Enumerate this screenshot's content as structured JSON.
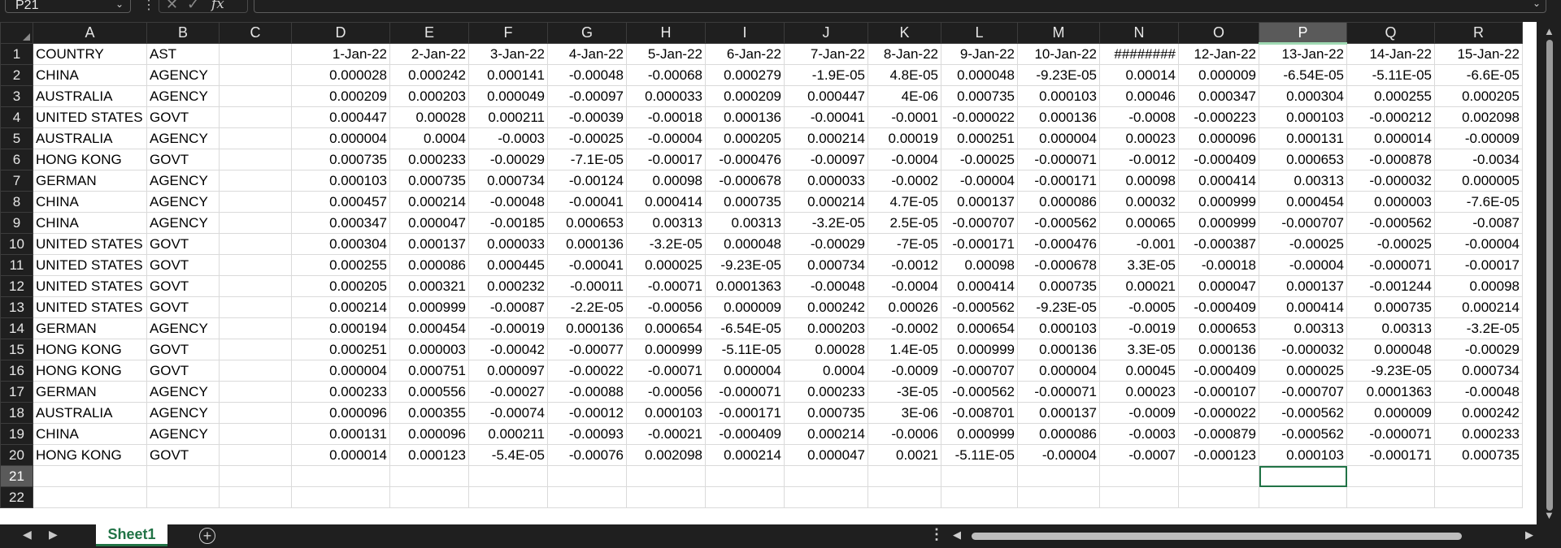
{
  "formula_bar": {
    "name_box": "P21",
    "fx": "fx",
    "formula": ""
  },
  "columns": [
    "A",
    "B",
    "C",
    "D",
    "E",
    "F",
    "G",
    "H",
    "I",
    "J",
    "K",
    "L",
    "M",
    "N",
    "O",
    "P",
    "Q",
    "R"
  ],
  "selected_column": "P",
  "selected_row": "21",
  "rows": [
    {
      "n": "1",
      "cells": [
        "COUNTRY",
        "AST",
        "",
        "1-Jan-22",
        "2-Jan-22",
        "3-Jan-22",
        "4-Jan-22",
        "5-Jan-22",
        "6-Jan-22",
        "7-Jan-22",
        "8-Jan-22",
        "9-Jan-22",
        "10-Jan-22",
        "########",
        "12-Jan-22",
        "13-Jan-22",
        "14-Jan-22",
        "15-Jan-22"
      ]
    },
    {
      "n": "2",
      "cells": [
        "CHINA",
        "AGENCY",
        "",
        "0.000028",
        "0.000242",
        "0.000141",
        "-0.00048",
        "-0.00068",
        "0.000279",
        "-1.9E-05",
        "4.8E-05",
        "0.000048",
        "-9.23E-05",
        "0.00014",
        "0.000009",
        "-6.54E-05",
        "-5.11E-05",
        "-6.6E-05"
      ]
    },
    {
      "n": "3",
      "cells": [
        "AUSTRALIA",
        "AGENCY",
        "",
        "0.000209",
        "0.000203",
        "0.000049",
        "-0.00097",
        "0.000033",
        "0.000209",
        "0.000447",
        "4E-06",
        "0.000735",
        "0.000103",
        "0.00046",
        "0.000347",
        "0.000304",
        "0.000255",
        "0.000205"
      ]
    },
    {
      "n": "4",
      "cells": [
        "UNITED STATES",
        "GOVT",
        "",
        "0.000447",
        "0.00028",
        "0.000211",
        "-0.00039",
        "-0.00018",
        "0.000136",
        "-0.00041",
        "-0.0001",
        "-0.000022",
        "0.000136",
        "-0.0008",
        "-0.000223",
        "0.000103",
        "-0.000212",
        "0.002098"
      ]
    },
    {
      "n": "5",
      "cells": [
        "AUSTRALIA",
        "AGENCY",
        "",
        "0.000004",
        "0.0004",
        "-0.0003",
        "-0.00025",
        "-0.00004",
        "0.000205",
        "0.000214",
        "0.00019",
        "0.000251",
        "0.000004",
        "0.00023",
        "0.000096",
        "0.000131",
        "0.000014",
        "-0.00009"
      ]
    },
    {
      "n": "6",
      "cells": [
        "HONG KONG",
        "GOVT",
        "",
        "0.000735",
        "0.000233",
        "-0.00029",
        "-7.1E-05",
        "-0.00017",
        "-0.000476",
        "-0.00097",
        "-0.0004",
        "-0.00025",
        "-0.000071",
        "-0.0012",
        "-0.000409",
        "0.000653",
        "-0.000878",
        "-0.0034"
      ]
    },
    {
      "n": "7",
      "cells": [
        "GERMAN",
        "AGENCY",
        "",
        "0.000103",
        "0.000735",
        "0.000734",
        "-0.00124",
        "0.00098",
        "-0.000678",
        "0.000033",
        "-0.0002",
        "-0.00004",
        "-0.000171",
        "0.00098",
        "0.000414",
        "0.00313",
        "-0.000032",
        "0.000005"
      ]
    },
    {
      "n": "8",
      "cells": [
        "CHINA",
        "AGENCY",
        "",
        "0.000457",
        "0.000214",
        "-0.00048",
        "-0.00041",
        "0.000414",
        "0.000735",
        "0.000214",
        "4.7E-05",
        "0.000137",
        "0.000086",
        "0.00032",
        "0.000999",
        "0.000454",
        "0.000003",
        "-7.6E-05"
      ]
    },
    {
      "n": "9",
      "cells": [
        "CHINA",
        "AGENCY",
        "",
        "0.000347",
        "0.000047",
        "-0.00185",
        "0.000653",
        "0.00313",
        "0.00313",
        "-3.2E-05",
        "2.5E-05",
        "-0.000707",
        "-0.000562",
        "0.00065",
        "0.000999",
        "-0.000707",
        "-0.000562",
        "-0.0087"
      ]
    },
    {
      "n": "10",
      "cells": [
        "UNITED STATES",
        "GOVT",
        "",
        "0.000304",
        "0.000137",
        "0.000033",
        "0.000136",
        "-3.2E-05",
        "0.000048",
        "-0.00029",
        "-7E-05",
        "-0.000171",
        "-0.000476",
        "-0.001",
        "-0.000387",
        "-0.00025",
        "-0.00025",
        "-0.00004"
      ]
    },
    {
      "n": "11",
      "cells": [
        "UNITED STATES",
        "GOVT",
        "",
        "0.000255",
        "0.000086",
        "0.000445",
        "-0.00041",
        "0.000025",
        "-9.23E-05",
        "0.000734",
        "-0.0012",
        "0.00098",
        "-0.000678",
        "3.3E-05",
        "-0.00018",
        "-0.00004",
        "-0.000071",
        "-0.00017"
      ]
    },
    {
      "n": "12",
      "cells": [
        "UNITED STATES",
        "GOVT",
        "",
        "0.000205",
        "0.000321",
        "0.000232",
        "-0.00011",
        "-0.00071",
        "0.0001363",
        "-0.00048",
        "-0.0004",
        "0.000414",
        "0.000735",
        "0.00021",
        "0.000047",
        "0.000137",
        "-0.001244",
        "0.00098"
      ]
    },
    {
      "n": "13",
      "cells": [
        "UNITED STATES",
        "GOVT",
        "",
        "0.000214",
        "0.000999",
        "-0.00087",
        "-2.2E-05",
        "-0.00056",
        "0.000009",
        "0.000242",
        "0.00026",
        "-0.000562",
        "-9.23E-05",
        "-0.0005",
        "-0.000409",
        "0.000414",
        "0.000735",
        "0.000214"
      ]
    },
    {
      "n": "14",
      "cells": [
        "GERMAN",
        "AGENCY",
        "",
        "0.000194",
        "0.000454",
        "-0.00019",
        "0.000136",
        "0.000654",
        "-6.54E-05",
        "0.000203",
        "-0.0002",
        "0.000654",
        "0.000103",
        "-0.0019",
        "0.000653",
        "0.00313",
        "0.00313",
        "-3.2E-05"
      ]
    },
    {
      "n": "15",
      "cells": [
        "HONG KONG",
        "GOVT",
        "",
        "0.000251",
        "0.000003",
        "-0.00042",
        "-0.00077",
        "0.000999",
        "-5.11E-05",
        "0.00028",
        "1.4E-05",
        "0.000999",
        "0.000136",
        "3.3E-05",
        "0.000136",
        "-0.000032",
        "0.000048",
        "-0.00029"
      ]
    },
    {
      "n": "16",
      "cells": [
        "HONG KONG",
        "GOVT",
        "",
        "0.000004",
        "0.000751",
        "0.000097",
        "-0.00022",
        "-0.00071",
        "0.000004",
        "0.0004",
        "-0.0009",
        "-0.000707",
        "0.000004",
        "0.00045",
        "-0.000409",
        "0.000025",
        "-9.23E-05",
        "0.000734"
      ]
    },
    {
      "n": "17",
      "cells": [
        "GERMAN",
        "AGENCY",
        "",
        "0.000233",
        "0.000556",
        "-0.00027",
        "-0.00088",
        "-0.00056",
        "-0.000071",
        "0.000233",
        "-3E-05",
        "-0.000562",
        "-0.000071",
        "0.00023",
        "-0.000107",
        "-0.000707",
        "0.0001363",
        "-0.00048"
      ]
    },
    {
      "n": "18",
      "cells": [
        "AUSTRALIA",
        "AGENCY",
        "",
        "0.000096",
        "0.000355",
        "-0.00074",
        "-0.00012",
        "0.000103",
        "-0.000171",
        "0.000735",
        "3E-06",
        "-0.008701",
        "0.000137",
        "-0.0009",
        "-0.000022",
        "-0.000562",
        "0.000009",
        "0.000242"
      ]
    },
    {
      "n": "19",
      "cells": [
        "CHINA",
        "AGENCY",
        "",
        "0.000131",
        "0.000096",
        "0.000211",
        "-0.00093",
        "-0.00021",
        "-0.000409",
        "0.000214",
        "-0.0006",
        "0.000999",
        "0.000086",
        "-0.0003",
        "-0.000879",
        "-0.000562",
        "-0.000071",
        "0.000233"
      ]
    },
    {
      "n": "20",
      "cells": [
        "HONG KONG",
        "GOVT",
        "",
        "0.000014",
        "0.000123",
        "-5.4E-05",
        "-0.00076",
        "0.002098",
        "0.000214",
        "0.000047",
        "0.0021",
        "-5.11E-05",
        "-0.00004",
        "-0.0007",
        "-0.000123",
        "0.000103",
        "-0.000171",
        "0.000735"
      ]
    },
    {
      "n": "21",
      "cells": [
        "",
        "",
        "",
        "",
        "",
        "",
        "",
        "",
        "",
        "",
        "",
        "",
        "",
        "",
        "",
        "",
        "",
        ""
      ]
    },
    {
      "n": "22",
      "cells": [
        "",
        "",
        "",
        "",
        "",
        "",
        "",
        "",
        "",
        "",
        "",
        "",
        "",
        "",
        "",
        "",
        "",
        ""
      ]
    }
  ],
  "sheet_tabs": [
    {
      "label": "Sheet1",
      "active": true
    }
  ],
  "add_sheet_symbol": "+",
  "colors": {
    "accent": "#217346",
    "header_bg": "#1f1f1f",
    "grid_line": "#dadada"
  }
}
